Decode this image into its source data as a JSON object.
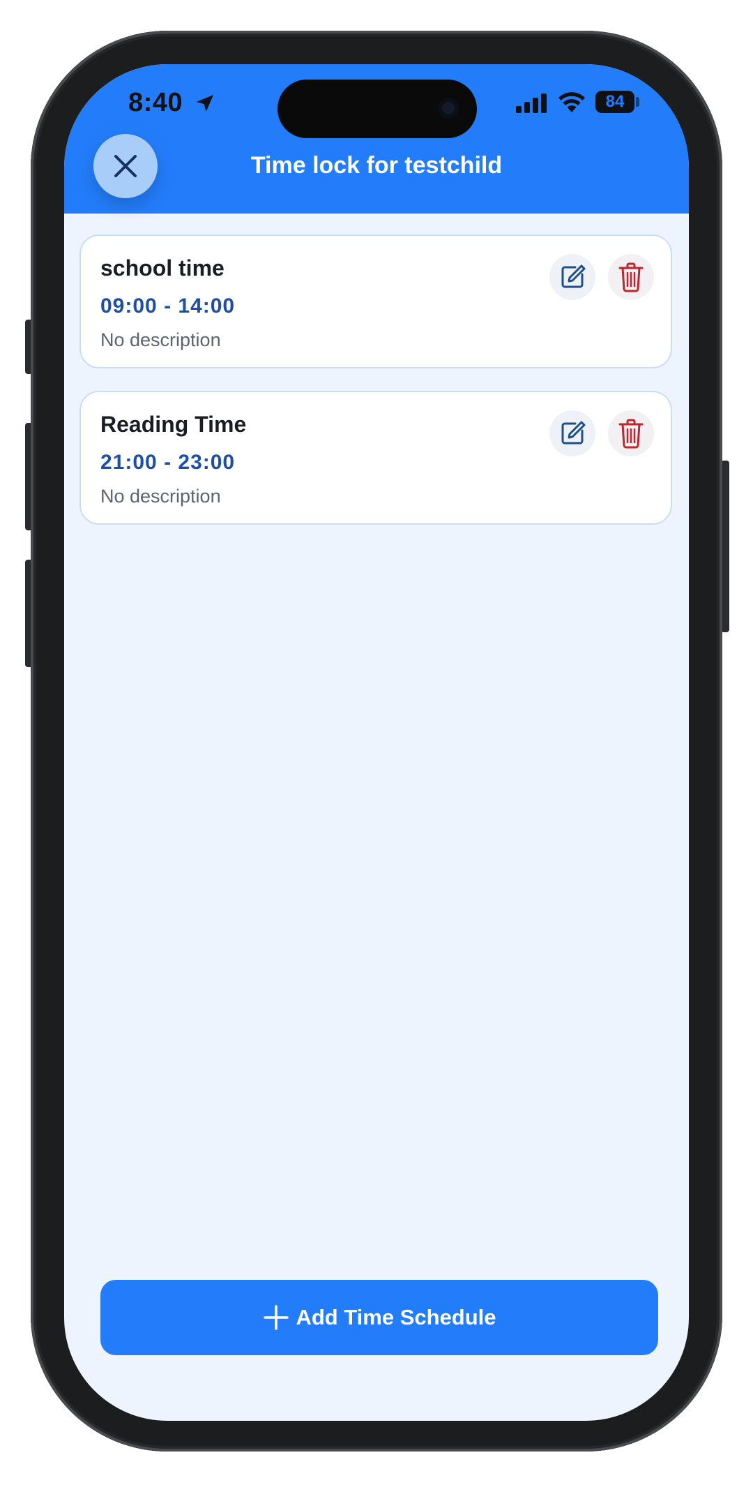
{
  "status_bar": {
    "time": "8:40",
    "battery": "84"
  },
  "header": {
    "title": "Time lock for testchild"
  },
  "schedules": [
    {
      "title": "school time",
      "time_range": "09:00 - 14:00",
      "description": "No description"
    },
    {
      "title": "Reading Time",
      "time_range": "21:00 - 23:00",
      "description": "No description"
    }
  ],
  "footer": {
    "add_label": "Add Time Schedule"
  },
  "colors": {
    "accent": "#237dfa",
    "time_text": "#1d4fa8",
    "delete": "#c0242c",
    "edit": "#1d4f8a",
    "background": "#eef4fd"
  },
  "icons": [
    "location-arrow-icon",
    "signal-icon",
    "wifi-icon",
    "battery-icon",
    "close-icon",
    "edit-icon",
    "trash-icon",
    "plus-icon"
  ]
}
